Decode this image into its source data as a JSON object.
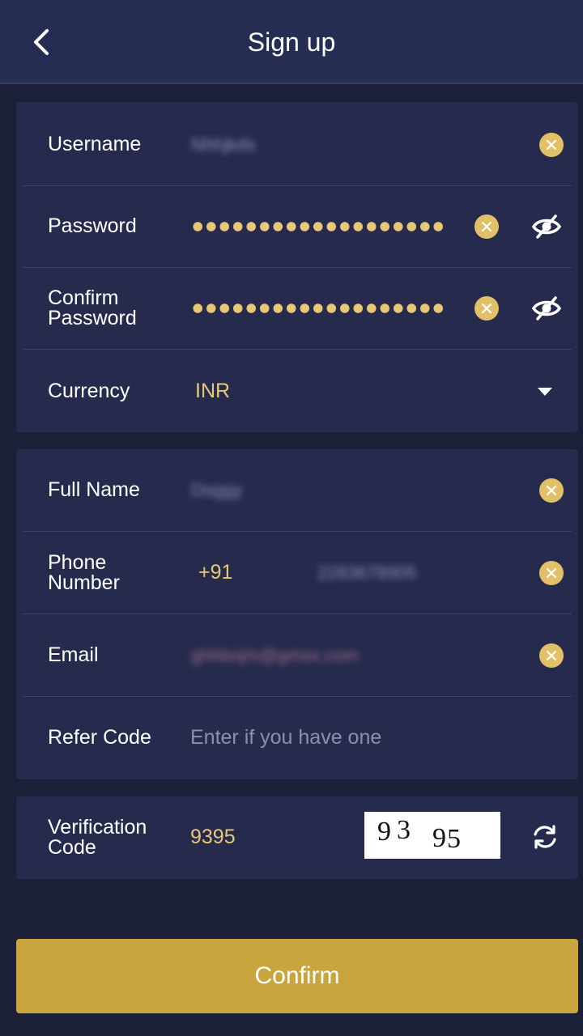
{
  "header": {
    "title": "Sign up",
    "back_icon": "chevron-left-icon"
  },
  "account": {
    "username": {
      "label": "Username",
      "value": "Nhhjkds"
    },
    "password": {
      "label": "Password",
      "value": "••••••••••••••••••••"
    },
    "confirm_password": {
      "label_line1": "Confirm",
      "label_line2": "Password",
      "value": "••••••••••••••••••••"
    },
    "currency": {
      "label": "Currency",
      "value": "INR"
    }
  },
  "profile": {
    "full_name": {
      "label": "Full Name",
      "value": "Doggy"
    },
    "phone": {
      "label_line1": "Phone",
      "label_line2": "Number",
      "country_code": "+91",
      "value": "2283678905"
    },
    "email": {
      "label": "Email",
      "value": "ghhbnjm@gmsx.com"
    },
    "refer_code": {
      "label": "Refer Code",
      "placeholder": "Enter if you have one"
    }
  },
  "verification": {
    "label_line1": "Verification",
    "label_line2": "Code",
    "value": "9395",
    "captcha_chars": [
      "9",
      "3",
      "9",
      "5"
    ]
  },
  "confirm_label": "Confirm",
  "colors": {
    "accent": "#e2c067",
    "button": "#c9a53e",
    "background": "#1b1f38",
    "card": "#262b4e"
  }
}
